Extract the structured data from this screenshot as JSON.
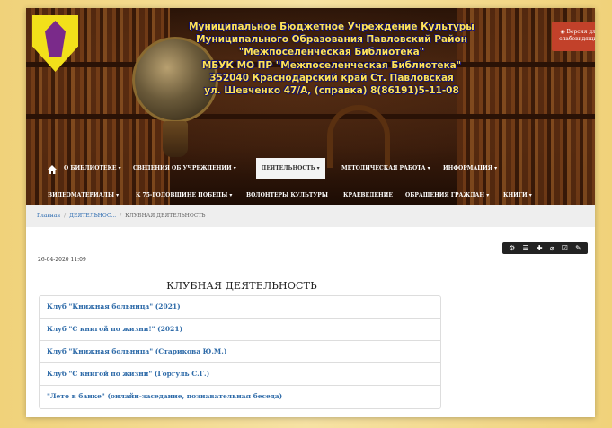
{
  "header": {
    "title_lines": [
      "Муниципальное Бюджетное Учреждение Культуры",
      "Муниципального Образования Павловский Район",
      "\"Межпоселенческая Библиотека\"",
      "МБУК МО ПР \"Межпоселенческая Библиотека\"",
      "352040 Краснодарский край Ст. Павловская",
      "ул. Шевченко 47/А, (справка) 8(86191)5-11-08"
    ],
    "version_button": "Версия для слабовидящих",
    "version_icon": "eye-icon"
  },
  "nav": {
    "row1": [
      {
        "label": "О БИБЛИОТЕКЕ ▾"
      },
      {
        "label": "СВЕДЕНИЯ ОБ УЧРЕЖДЕНИИ ▾"
      },
      {
        "label": "ДЕЯТЕЛЬНОСТЬ ▾"
      },
      {
        "label": "МЕТОДИЧЕСКАЯ РАБОТА ▾"
      },
      {
        "label": "ИНФОРМАЦИЯ ▾"
      }
    ],
    "row2": [
      {
        "label": "ВИДЕОМАТЕРИАЛЫ ▾"
      },
      {
        "label": "К 75-ГОДОВЩИНЕ ПОБЕДЫ ▾"
      },
      {
        "label": "ВОЛОНТЕРЫ КУЛЬТУРЫ"
      },
      {
        "label": "КРАЕВЕДЕНИЕ"
      },
      {
        "label": "ОБРАЩЕНИЯ ГРАЖДАН ▾"
      },
      {
        "label": "КНИГИ ▾"
      }
    ],
    "home_icon": "home-icon"
  },
  "breadcrumb": {
    "home": "Главная",
    "parent": "ДЕЯТЕЛЬНОС...",
    "current": "КЛУБНАЯ ДЕЯТЕЛЬНОСТЬ"
  },
  "toolbar": {
    "icons": [
      "gear-icon",
      "list-icon",
      "plus-icon",
      "paperclip-icon",
      "check-square-icon",
      "pencil-icon"
    ]
  },
  "article": {
    "date": "26-04-2020 11:09",
    "title": "КЛУБНАЯ ДЕЯТЕЛЬНОСТЬ",
    "items": [
      "Клуб \"Книжная больница\" (2021)",
      "Клуб \"С книгой по жизни!\" (2021)",
      "Клуб \"Книжная больница\" (Старикова Ю.М.)",
      "Клуб \"С книгой по жизни\" (Горгуль С.Г.)",
      "\"Лето в банке\" (онлайн-заседание, познавательная беседа)"
    ]
  },
  "colors": {
    "page_background": "#f2d98a",
    "title_text": "#ffe25a",
    "version_button": "#c2412a",
    "link": "#2d6aa8"
  }
}
